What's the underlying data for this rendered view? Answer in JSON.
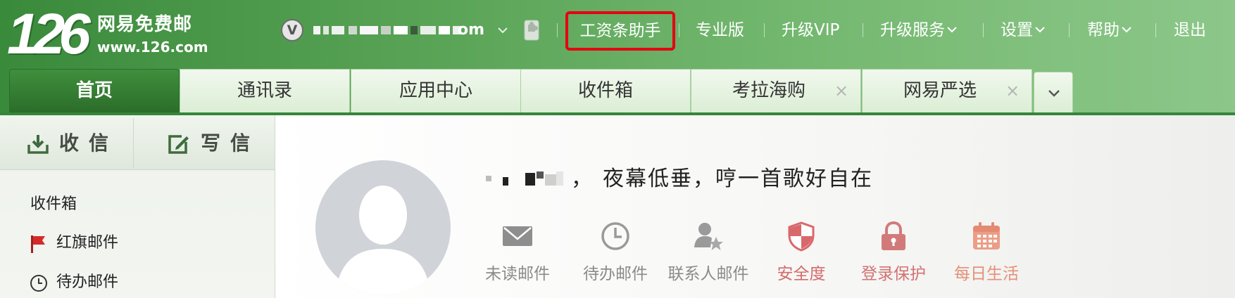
{
  "app": {
    "logo_number": "126",
    "logo_name": "网易免费邮",
    "logo_url": "www.126.com"
  },
  "account": {
    "vip_badge": "V",
    "email_visible_suffix": "om"
  },
  "topnav": {
    "highlighted": "工资条助手",
    "items": [
      {
        "label": "专业版",
        "dropdown": false
      },
      {
        "label": "升级VIP",
        "dropdown": false
      },
      {
        "label": "升级服务",
        "dropdown": true
      },
      {
        "label": "设置",
        "dropdown": true
      },
      {
        "label": "帮助",
        "dropdown": true
      },
      {
        "label": "退出",
        "dropdown": false
      }
    ]
  },
  "tabs": [
    {
      "label": "首页",
      "active": true,
      "closable": false
    },
    {
      "label": "通讯录",
      "active": false,
      "closable": false
    },
    {
      "label": "应用中心",
      "active": false,
      "closable": false
    },
    {
      "label": "收件箱",
      "active": false,
      "closable": false
    },
    {
      "label": "考拉海购",
      "active": false,
      "closable": true
    },
    {
      "label": "网易严选",
      "active": false,
      "closable": true
    }
  ],
  "sidebar": {
    "receive_label": "收信",
    "compose_label": "写信",
    "items": [
      {
        "label": "收件箱",
        "icon": ""
      },
      {
        "label": "红旗邮件",
        "icon": "red-flag-icon"
      },
      {
        "label": "待办邮件",
        "icon": "clock-icon"
      }
    ]
  },
  "greeting": {
    "name_suffix": "，",
    "message": "夜幕低垂，哼一首歌好自在"
  },
  "shortcuts": [
    {
      "label": "未读邮件",
      "icon": "envelope-icon",
      "color": "#8b8b8b"
    },
    {
      "label": "待办邮件",
      "icon": "clock-icon",
      "color": "#8b8b8b"
    },
    {
      "label": "联系人邮件",
      "icon": "contacts-star-icon",
      "color": "#8b8b8b"
    },
    {
      "label": "安全度",
      "icon": "shield-icon",
      "color": "#d46a6a"
    },
    {
      "label": "登录保护",
      "icon": "lock-icon",
      "color": "#d27272"
    },
    {
      "label": "每日生活",
      "icon": "calendar-icon",
      "color": "#e59078"
    }
  ],
  "colors": {
    "header_green_dark": "#3a8a3c",
    "header_green_light": "#8cc789",
    "highlight_box": "#e60012",
    "active_tab": "#2b6d2a"
  }
}
